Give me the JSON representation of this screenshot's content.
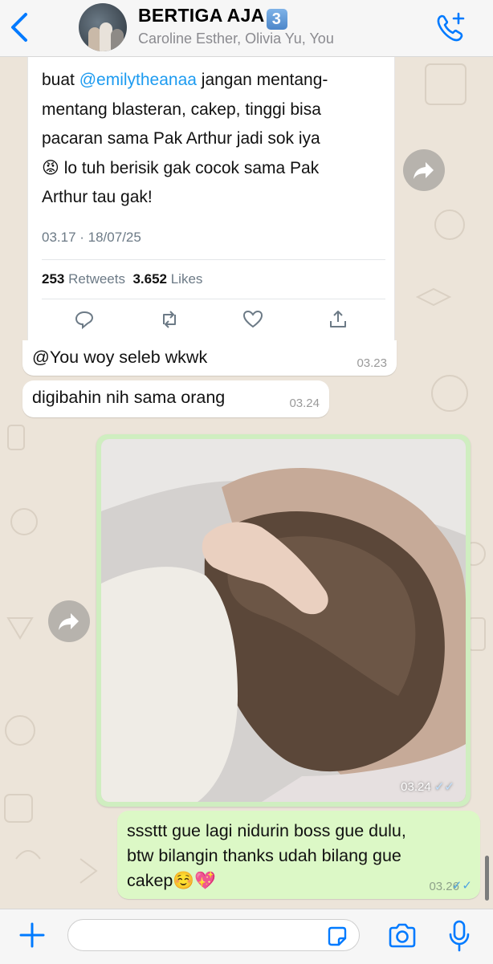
{
  "header": {
    "group_name": "BERTIGA AJA",
    "group_badge": "3",
    "members": "Caroline Esther, Olivia Yu, You"
  },
  "tweet": {
    "text_before": "buat ",
    "mention": "@emilytheanaa",
    "text_line1_rest": " jangan mentang-",
    "line2": "mentang blasteran, cakep, tinggi bisa",
    "line3": "pacaran sama Pak Arthur jadi sok iya",
    "emoji": "😡",
    "line4_rest": " lo tuh berisik gak cocok sama Pak",
    "line5": "Arthur tau gak!",
    "time": "03.17 · 18/07/25",
    "retweets_count": "253",
    "retweets_label": "Retweets",
    "likes_count": "3.652",
    "likes_label": "Likes"
  },
  "messages": [
    {
      "text": "@You woy seleb wkwk",
      "time": "03.23"
    },
    {
      "text": "digibahin nih sama orang",
      "time": "03.24"
    }
  ],
  "image_message": {
    "time": "03.24"
  },
  "outgoing": {
    "line1": "sssttt gue lagi nidurin boss gue dulu,",
    "line2": "btw bilangin thanks udah bilang gue",
    "line3": "cakep",
    "emojis": "☺️💖",
    "time": "03.26"
  },
  "input": {
    "placeholder": ""
  },
  "colors": {
    "accent": "#007aff",
    "outgoing_bubble": "#dcf8c6",
    "tweet_blue": "#1d9bf0"
  }
}
